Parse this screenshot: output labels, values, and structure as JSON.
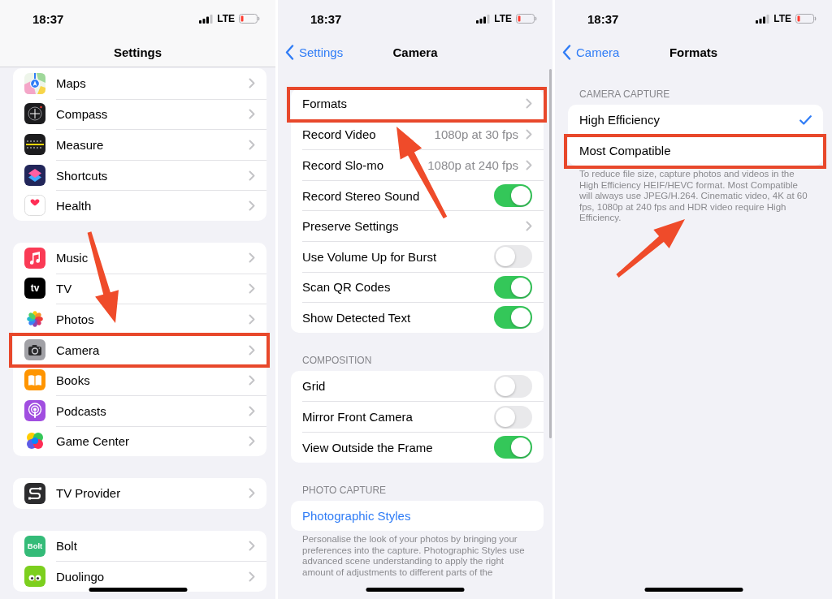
{
  "panels": [
    {
      "scrolled": true,
      "status_bar": {
        "time": "18:37",
        "network": "LTE"
      },
      "nav": {
        "title": "Settings"
      },
      "groups": [
        {
          "rows": [
            {
              "kind": "app",
              "label": "Maps",
              "highlighted": false
            },
            {
              "kind": "app",
              "label": "Compass",
              "highlighted": false
            },
            {
              "kind": "app",
              "label": "Measure",
              "highlighted": false
            },
            {
              "kind": "app",
              "label": "Shortcuts",
              "highlighted": false
            },
            {
              "kind": "app",
              "label": "Health",
              "highlighted": false
            }
          ]
        },
        {
          "rows": [
            {
              "kind": "app",
              "label": "Music",
              "highlighted": false
            },
            {
              "kind": "app",
              "label": "TV",
              "icon_text": "tv",
              "highlighted": false
            },
            {
              "kind": "app",
              "label": "Photos",
              "highlighted": false
            },
            {
              "kind": "app",
              "label": "Camera",
              "highlighted": true
            },
            {
              "kind": "app",
              "label": "Books",
              "highlighted": false
            },
            {
              "kind": "app",
              "label": "Podcasts",
              "highlighted": false
            },
            {
              "kind": "app",
              "label": "Game Center",
              "highlighted": false
            }
          ]
        },
        {
          "rows": [
            {
              "kind": "app",
              "label": "TV Provider",
              "highlighted": false
            }
          ]
        },
        {
          "rows": [
            {
              "kind": "app",
              "label": "Bolt",
              "icon_text": "Bolt",
              "highlighted": false
            },
            {
              "kind": "app",
              "label": "Duolingo",
              "highlighted": false
            }
          ]
        }
      ]
    },
    {
      "scrolled": false,
      "status_bar": {
        "time": "18:37",
        "network": "LTE"
      },
      "nav": {
        "back": "Settings",
        "title": "Camera"
      },
      "groups": [
        {
          "rows": [
            {
              "kind": "link",
              "label": "Formats",
              "highlighted": true
            },
            {
              "kind": "link",
              "label": "Record Video",
              "value": "1080p at 30 fps",
              "highlighted": false
            },
            {
              "kind": "link",
              "label": "Record Slo-mo",
              "value": "1080p at 240 fps",
              "highlighted": false
            },
            {
              "kind": "toggle",
              "label": "Record Stereo Sound",
              "on": true,
              "highlighted": false
            },
            {
              "kind": "link",
              "label": "Preserve Settings",
              "highlighted": false
            },
            {
              "kind": "toggle",
              "label": "Use Volume Up for Burst",
              "on": false,
              "highlighted": false
            },
            {
              "kind": "toggle",
              "label": "Scan QR Codes",
              "on": true,
              "highlighted": false
            },
            {
              "kind": "toggle",
              "label": "Show Detected Text",
              "on": true,
              "highlighted": false
            }
          ]
        },
        {
          "header": "COMPOSITION",
          "rows": [
            {
              "kind": "toggle",
              "label": "Grid",
              "on": false,
              "highlighted": false
            },
            {
              "kind": "toggle",
              "label": "Mirror Front Camera",
              "on": false,
              "highlighted": false
            },
            {
              "kind": "toggle",
              "label": "View Outside the Frame",
              "on": true,
              "highlighted": false
            }
          ]
        },
        {
          "header": "PHOTO CAPTURE",
          "rows": [
            {
              "kind": "action",
              "label": "Photographic Styles",
              "highlighted": false
            }
          ],
          "footer": "Personalise the look of your photos by bringing your preferences into the capture. Photographic Styles use advanced scene understanding to apply the right amount of adjustments to different parts of the"
        }
      ]
    },
    {
      "scrolled": false,
      "status_bar": {
        "time": "18:37",
        "network": "LTE"
      },
      "nav": {
        "back": "Camera",
        "title": "Formats"
      },
      "groups": [
        {
          "header": "CAMERA CAPTURE",
          "rows": [
            {
              "kind": "choice",
              "label": "High Efficiency",
              "selected": true,
              "highlighted": false
            },
            {
              "kind": "choice",
              "label": "Most Compatible",
              "selected": false,
              "highlighted": true
            }
          ],
          "footer": "To reduce file size, capture photos and videos in the High Efficiency HEIF/HEVC format. Most Compatible will always use JPEG/H.264. Cinematic video, 4K at 60 fps, 1080p at 240 fps and HDR video require High Efficiency."
        }
      ]
    }
  ]
}
